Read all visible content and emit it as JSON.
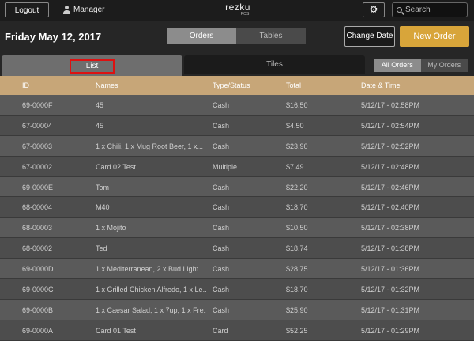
{
  "topbar": {
    "logout_label": "Logout",
    "user_label": "Manager",
    "logo_name": "rezku",
    "logo_sub": "POS",
    "search_placeholder": "Search"
  },
  "subbar": {
    "date": "Friday May 12, 2017",
    "view_tabs": [
      {
        "label": "Orders"
      },
      {
        "label": "Tables"
      }
    ],
    "change_date_label": "Change Date",
    "new_order_label": "New Order"
  },
  "tabbar": {
    "list_label": "List",
    "tiles_label": "Tiles",
    "filter": [
      {
        "label": "All Orders"
      },
      {
        "label": "My Orders"
      }
    ]
  },
  "table": {
    "headers": {
      "id": "ID",
      "names": "Names",
      "type": "Type/Status",
      "total": "Total",
      "datetime": "Date & Time"
    },
    "rows": [
      {
        "id": "69-0000F",
        "names": "45",
        "type": "Cash",
        "total": "$16.50",
        "datetime": "5/12/17 - 02:58PM"
      },
      {
        "id": "67-00004",
        "names": "45",
        "type": "Cash",
        "total": "$4.50",
        "datetime": "5/12/17 - 02:54PM"
      },
      {
        "id": "67-00003",
        "names": "1 x Chili, 1 x Mug Root Beer, 1 x...",
        "type": "Cash",
        "total": "$23.90",
        "datetime": "5/12/17 - 02:52PM"
      },
      {
        "id": "67-00002",
        "names": "Card 02 Test",
        "type": "Multiple",
        "total": "$7.49",
        "datetime": "5/12/17 - 02:48PM"
      },
      {
        "id": "69-0000E",
        "names": "Tom",
        "type": "Cash",
        "total": "$22.20",
        "datetime": "5/12/17 - 02:46PM"
      },
      {
        "id": "68-00004",
        "names": "M40",
        "type": "Cash",
        "total": "$18.70",
        "datetime": "5/12/17 - 02:40PM"
      },
      {
        "id": "68-00003",
        "names": "1 x Mojito",
        "type": "Cash",
        "total": "$10.50",
        "datetime": "5/12/17 - 02:38PM"
      },
      {
        "id": "68-00002",
        "names": "Ted",
        "type": "Cash",
        "total": "$18.74",
        "datetime": "5/12/17 - 01:38PM"
      },
      {
        "id": "69-0000D",
        "names": "1 x Mediterranean, 2 x Bud Light...",
        "type": "Cash",
        "total": "$28.75",
        "datetime": "5/12/17 - 01:36PM"
      },
      {
        "id": "69-0000C",
        "names": "1 x Grilled Chicken Alfredo, 1 x Le...",
        "type": "Cash",
        "total": "$18.70",
        "datetime": "5/12/17 - 01:32PM"
      },
      {
        "id": "69-0000B",
        "names": "1 x Caesar Salad, 1 x 7up, 1 x Fre...",
        "type": "Cash",
        "total": "$25.90",
        "datetime": "5/12/17 - 01:31PM"
      },
      {
        "id": "69-0000A",
        "names": "Card 01 Test",
        "type": "Card",
        "total": "$52.25",
        "datetime": "5/12/17 - 01:29PM"
      }
    ]
  }
}
